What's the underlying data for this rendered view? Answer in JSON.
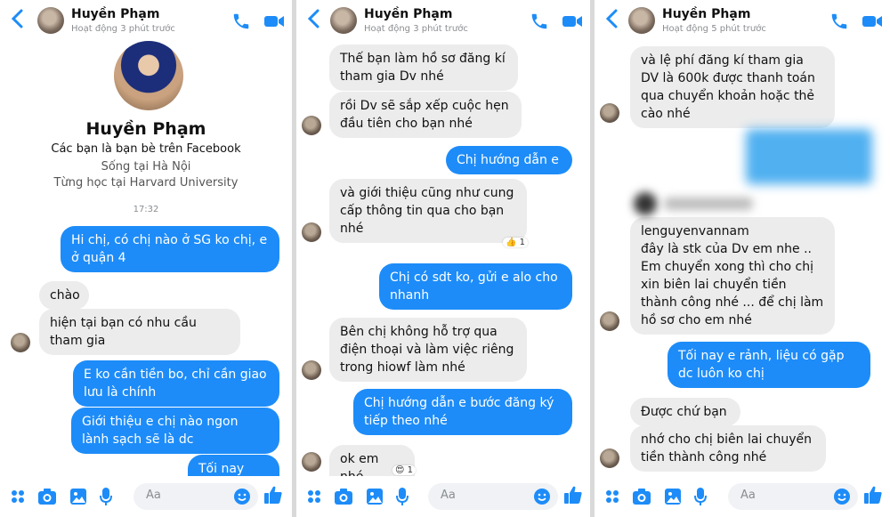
{
  "contact": {
    "name": "Huyền Phạm",
    "status_p1": "Hoạt động 3 phút trước",
    "status_p2": "Hoạt động 3 phút trước",
    "status_p3": "Hoạt động 5 phút trước"
  },
  "colors": {
    "accent": "#1d8cf8",
    "incoming_bubble": "#ececec",
    "outgoing_bubble": "#1d8cf8"
  },
  "profile": {
    "name": "Huyền Phạm",
    "friends_line": "Các bạn là bạn bè trên Facebook",
    "lives": "Sống tại Hà Nội",
    "studied": "Từng học tại Harvard University",
    "time": "17:32"
  },
  "panel1": {
    "messages": [
      {
        "dir": "out",
        "text": "Hi chị, có chị nào ở SG ko chị, e ở quận 4"
      },
      {
        "dir": "in",
        "text": "chào"
      },
      {
        "dir": "in",
        "text": "hiện tại bạn có nhu cầu tham gia"
      },
      {
        "dir": "out",
        "text": "E ko cần tiền bo, chỉ cần giao lưu là chính"
      },
      {
        "dir": "out",
        "text": "Giới thiệu e chị nào ngon lành sạch sẽ là dc"
      },
      {
        "dir": "out",
        "text": "Tối nay nhé"
      }
    ]
  },
  "panel2": {
    "messages": [
      {
        "dir": "in",
        "text": "Thế bạn làm hồ sơ đăng kí tham gia Dv nhé"
      },
      {
        "dir": "in",
        "text": "rồi Dv sẽ sắp xếp cuộc hẹn đầu tiên cho bạn nhé"
      },
      {
        "dir": "out",
        "text": "Chị hướng dẫn e"
      },
      {
        "dir": "in",
        "text": "và giới thiệu cũng như cung cấp thông tin qua cho bạn nhé"
      },
      {
        "dir": "out",
        "text": "Chị có sdt ko, gửi e alo cho nhanh"
      },
      {
        "dir": "in",
        "text": "Bên chị không hỗ trợ qua điện thoại và làm việc riêng trong hiowf làm nhé"
      },
      {
        "dir": "out",
        "text": "Chị hướng dẫn e bước đăng ký tiếp theo nhé"
      },
      {
        "dir": "in",
        "text": "ok em nhé"
      }
    ],
    "reaction_like": "👍 1",
    "reaction_emoji": "😍 1"
  },
  "panel3": {
    "messages": [
      {
        "dir": "in",
        "text": "và lệ phí đăng kí tham gia DV là 600k được thanh toán qua chuyển khoản hoặc thẻ cào nhé"
      },
      {
        "dir": "in",
        "text": "lenguyenvannam\nđây là stk của Dv em nhe ..\nEm chuyển xong thì cho chị xin biên lai chuyển tiền thành công nhé ... để chị làm hồ sơ cho em nhé"
      },
      {
        "dir": "out",
        "text": "Tối nay e rảnh, liệu có gặp dc luôn ko chị"
      },
      {
        "dir": "in",
        "text": "Được chứ bạn"
      },
      {
        "dir": "in",
        "text": "nhớ cho chị biên lai chuyển tiền thành công nhé"
      }
    ]
  },
  "composer": {
    "placeholder": "Aa"
  },
  "icons": [
    "back-icon",
    "phone-icon",
    "video-icon",
    "menu-dots-icon",
    "camera-icon",
    "image-icon",
    "mic-icon",
    "smile-icon",
    "thumbs-up-icon"
  ]
}
